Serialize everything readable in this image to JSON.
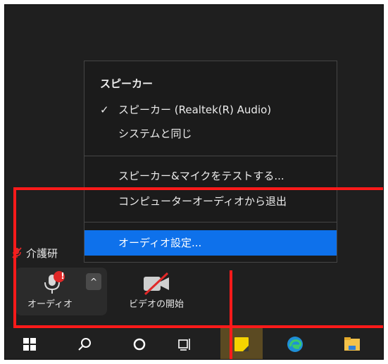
{
  "menu": {
    "header": "スピーカー",
    "check_mark": "✓",
    "items": [
      {
        "label": "スピーカー (Realtek(R) Audio)",
        "checked": true
      },
      {
        "label": "システムと同じ",
        "checked": false
      },
      {
        "label": "スピーカー&マイクをテストする...",
        "checked": false
      },
      {
        "label": "コンピューターオーディオから退出",
        "checked": false
      },
      {
        "label": "オーディオ設定...",
        "checked": false,
        "selected": true
      }
    ]
  },
  "meeting": {
    "name": "介護研"
  },
  "toolbar": {
    "audio_label": "オーディオ",
    "audio_alert": "!",
    "chevron": "^",
    "video_label": "ビデオの開始"
  },
  "taskbar": {
    "icons": [
      "windows-start-icon",
      "search-icon",
      "cortana-icon",
      "task-view-icon",
      "sticky-notes-icon",
      "edge-icon",
      "file-explorer-icon"
    ]
  },
  "colors": {
    "selection": "#0e71eb",
    "annotation": "#ff1a1a",
    "muted_red": "#e02828",
    "background": "#1f1f1f"
  }
}
